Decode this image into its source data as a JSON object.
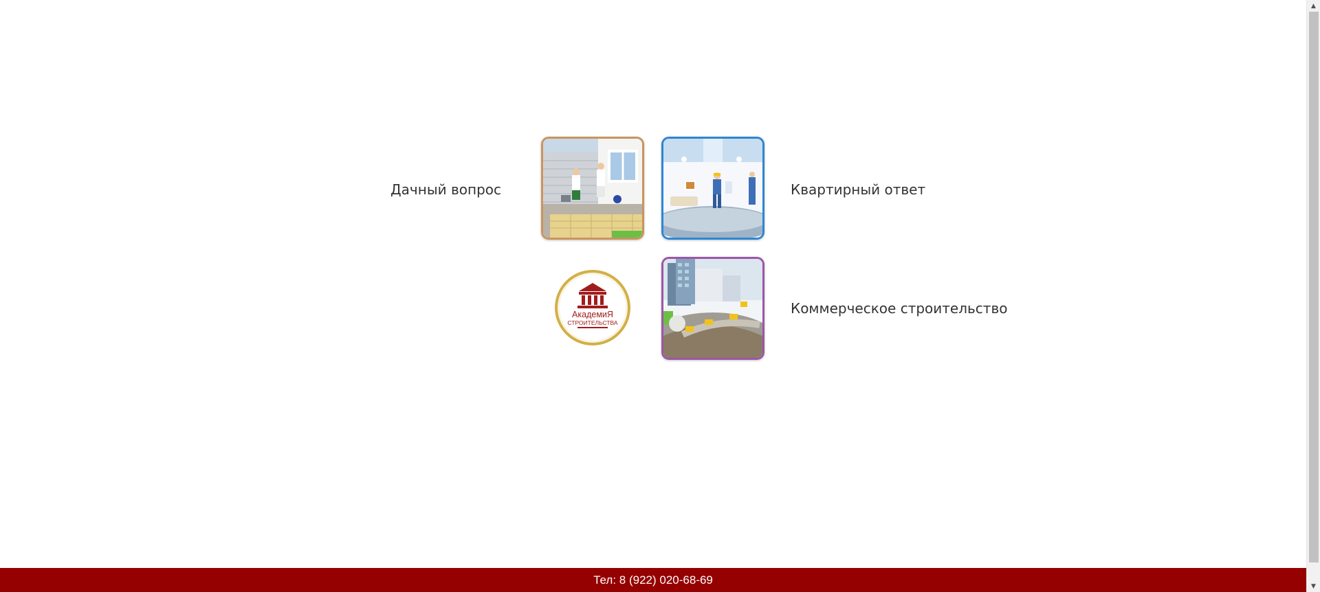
{
  "menu": {
    "dacha": {
      "label": "Дачный вопрос",
      "accent": "#c9955f"
    },
    "kvartira": {
      "label": "Квартирный ответ",
      "accent": "#2f86d3"
    },
    "kommerciya": {
      "label": "Коммерческое строительство",
      "accent": "#9b57a8"
    }
  },
  "logo": {
    "line1": "АкадемиЯ",
    "line2": "СТРОИТЕЛЬСТВА",
    "color": "#a11c1c",
    "ring": "#d2b048"
  },
  "footer": {
    "phone": "Тел: 8 (922) 020-68-69",
    "background": "#950000"
  },
  "scrollbar": {
    "up_icon": "triangle-up-icon",
    "down_icon": "triangle-down-icon"
  }
}
